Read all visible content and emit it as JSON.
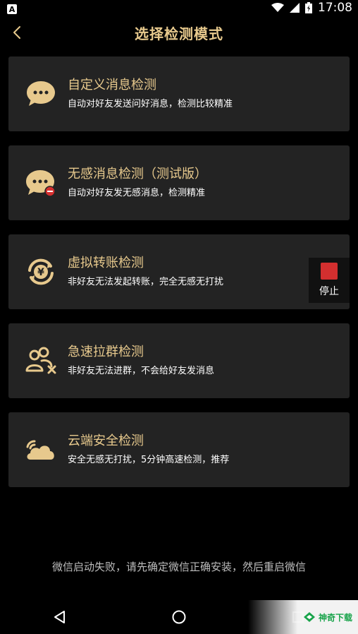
{
  "status_bar": {
    "left_badge": "A",
    "time": "17:08",
    "icons": [
      "wifi-icon",
      "signal-icon",
      "battery-icon"
    ]
  },
  "header": {
    "title": "选择检测模式",
    "back_icon": "chevron-left-icon"
  },
  "modes": [
    {
      "title": "自定义消息检测",
      "desc": "自动对好友发送问好消息，检测比较精准",
      "icon": "chat-dots-icon"
    },
    {
      "title": "无感消息检测（测试版）",
      "desc": "自动对好友发无感消息，检测精准",
      "icon": "chat-block-icon"
    },
    {
      "title": "虚拟转账检测",
      "desc": "非好友无法发起转账，完全无感无打扰",
      "icon": "yuan-transfer-icon"
    },
    {
      "title": "急速拉群检测",
      "desc": "非好友无法进群，不会给好友发消息",
      "icon": "group-icon"
    },
    {
      "title": "云端安全检测",
      "desc": "安全无感无打扰，5分钟高速检测，推荐",
      "icon": "cloud-icon"
    }
  ],
  "floating": {
    "label": "停止",
    "color": "#D32F2F"
  },
  "footer_message": "微信启动失败，请先确定微信正确安装，然后重启微信",
  "nav": {
    "icons": [
      "back-triangle-icon",
      "home-circle-icon",
      "recents-square-icon"
    ]
  },
  "watermark": {
    "text": "神奇下载"
  },
  "colors": {
    "accent": "#E7C98D",
    "card_bg": "#232323",
    "background": "#000000"
  }
}
